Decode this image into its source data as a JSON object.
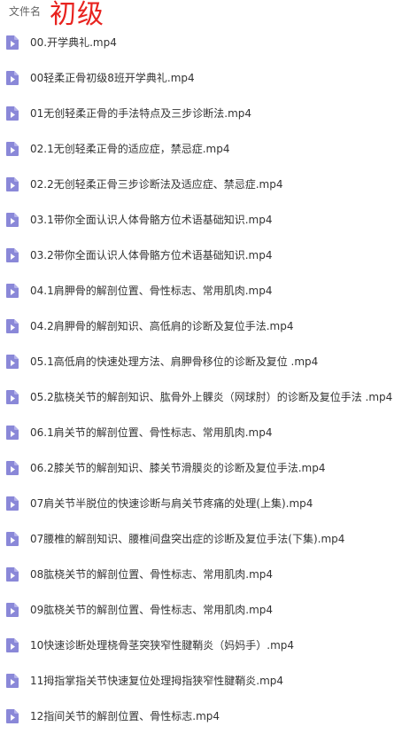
{
  "header": {
    "column_name": "文件名",
    "overlay_title": "初级"
  },
  "icon": {
    "name": "video-file-icon",
    "color": "#8a88d8",
    "fold_color": "#b3b1ea",
    "glyph_color": "#ffffff"
  },
  "files": [
    {
      "name": "00.开学典礼.mp4"
    },
    {
      "name": "00轻柔正骨初级8班开学典礼.mp4"
    },
    {
      "name": "01无创轻柔正骨的手法特点及三步诊断法.mp4"
    },
    {
      "name": "02.1无创轻柔正骨的适应症，禁忌症.mp4"
    },
    {
      "name": "02.2无创轻柔正骨三步诊断法及适应症、禁忌症.mp4"
    },
    {
      "name": "03.1带你全面认识人体骨骼方位术语基础知识.mp4"
    },
    {
      "name": "03.2带你全面认识人体骨骼方位术语基础知识.mp4"
    },
    {
      "name": "04.1肩胛骨的解剖位置、骨性标志、常用肌肉.mp4"
    },
    {
      "name": "04.2肩胛骨的解剖知识、高低肩的诊断及复位手法.mp4"
    },
    {
      "name": "05.1高低肩的快速处理方法、肩胛骨移位的诊断及复位 .mp4"
    },
    {
      "name": "05.2肱桡关节的解剖知识、肱骨外上髁炎（网球肘）的诊断及复位手法 .mp4"
    },
    {
      "name": "06.1肩关节的解剖位置、骨性标志、常用肌肉.mp4"
    },
    {
      "name": "06.2膝关节的解剖知识、膝关节滑膜炎的诊断及复位手法.mp4"
    },
    {
      "name": "07肩关节半脱位的快速诊断与肩关节疼痛的处理(上集).mp4"
    },
    {
      "name": "07腰椎的解剖知识、腰椎间盘突出症的诊断及复位手法(下集).mp4"
    },
    {
      "name": "08肱桡关节的解剖位置、骨性标志、常用肌肉.mp4"
    },
    {
      "name": "09肱桡关节的解剖位置、骨性标志、常用肌肉.mp4"
    },
    {
      "name": "10快速诊断处理桡骨茎突狭窄性腱鞘炎（妈妈手）.mp4"
    },
    {
      "name": "11拇指掌指关节快速复位处理拇指狭窄性腱鞘炎.mp4"
    },
    {
      "name": "12指间关节的解剖位置、骨性标志.mp4"
    }
  ]
}
